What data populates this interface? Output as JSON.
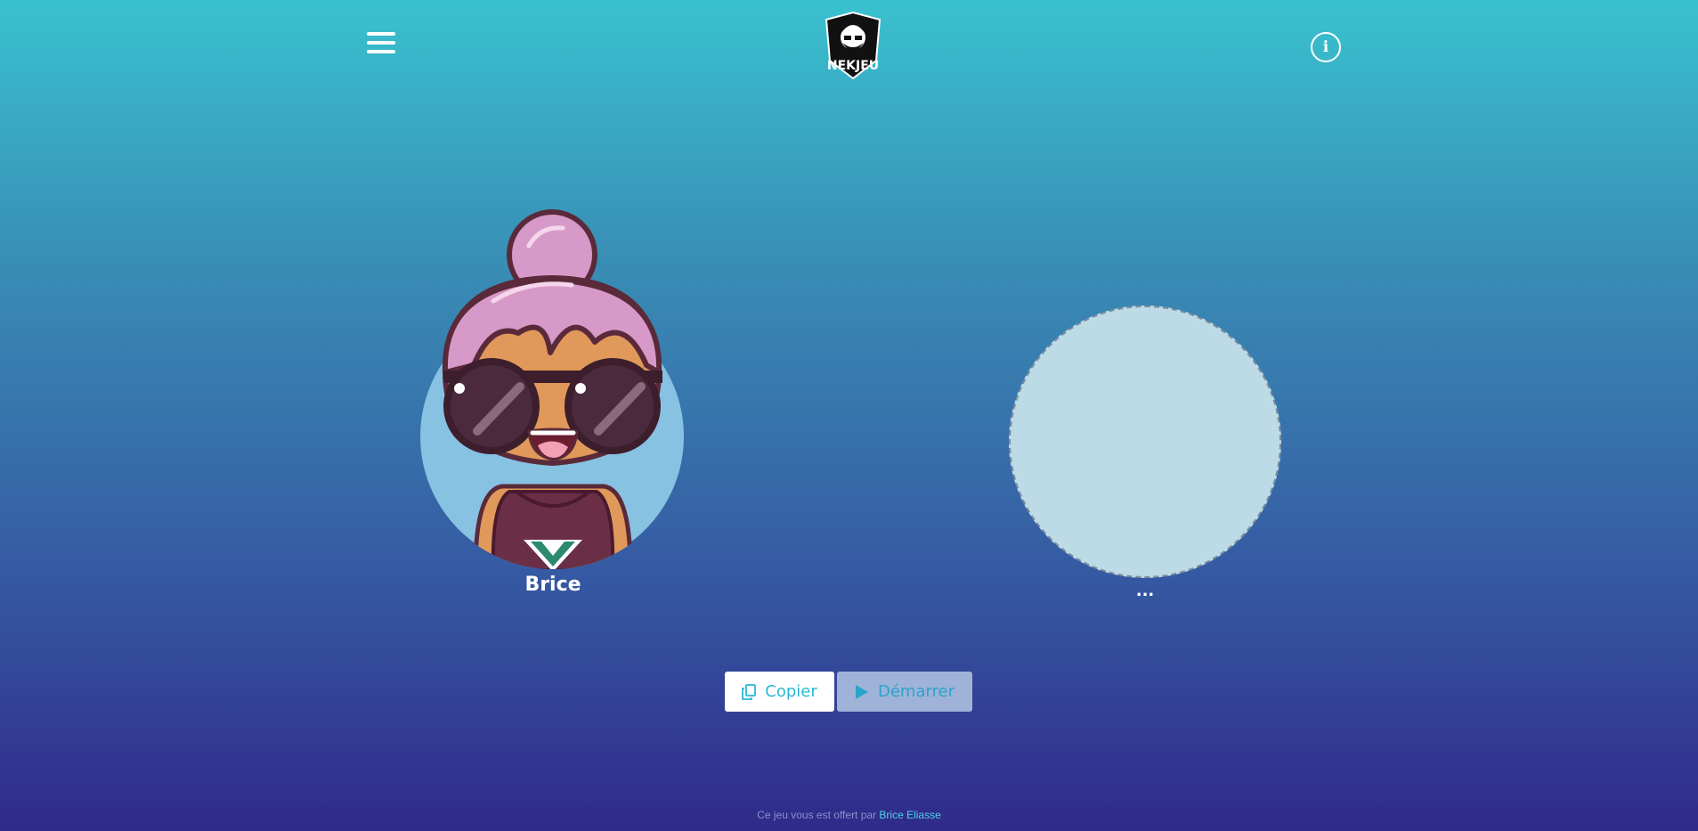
{
  "header": {
    "menu_icon": "hamburger-menu-icon",
    "logo_text": "NEKJEU",
    "info_icon": "info-icon",
    "info_glyph": "i"
  },
  "players": [
    {
      "name": "Brice",
      "avatar": "pink-bun-sunglasses-avatar"
    },
    {
      "name": "...",
      "avatar": "empty-slot"
    }
  ],
  "actions": {
    "copy_label": "Copier",
    "copy_icon": "copy-icon",
    "start_label": "Démarrer",
    "start_icon": "play-icon"
  },
  "footer": {
    "text": "Ce jeu vous est offert par",
    "author": "Brice Eliasse"
  },
  "colors": {
    "gradient_top": "#39c1cf",
    "gradient_bottom": "#302a8a",
    "accent": "#2bb8d3"
  }
}
